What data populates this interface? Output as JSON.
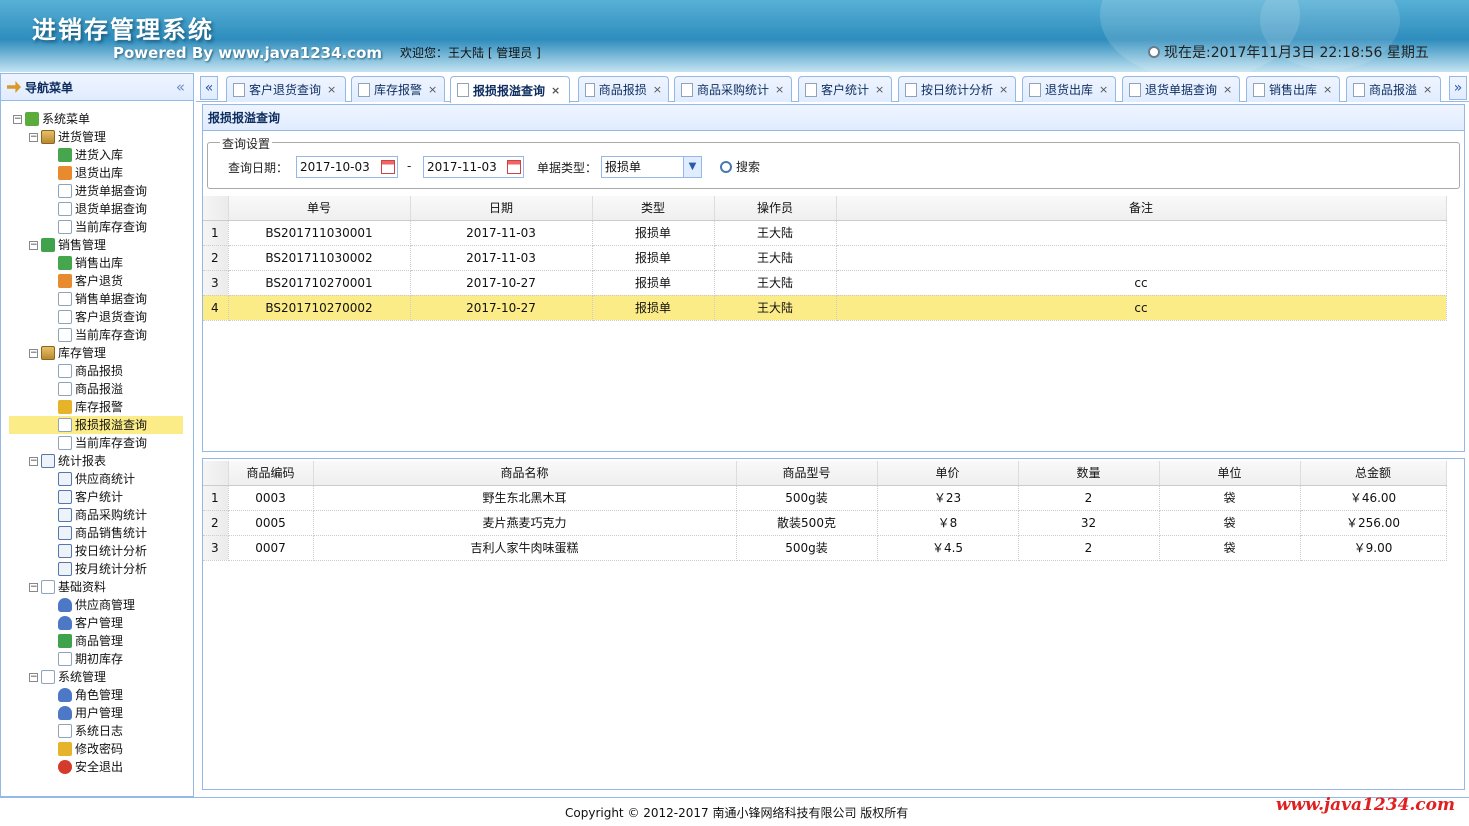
{
  "header": {
    "title": "进销存管理系统",
    "subtitle": "Powered By www.java1234.com",
    "welcome": "欢迎您：王大陆 [ 管理员 ]",
    "clock": "现在是:2017年11月3日 22:18:56 星期五"
  },
  "sidebar": {
    "title": "导航菜单",
    "collapse": "«",
    "root": "系统菜单",
    "groups": [
      {
        "label": "进货管理",
        "items": [
          "进货入库",
          "退货出库",
          "进货单据查询",
          "退货单据查询",
          "当前库存查询"
        ]
      },
      {
        "label": "销售管理",
        "items": [
          "销售出库",
          "客户退货",
          "销售单据查询",
          "客户退货查询",
          "当前库存查询"
        ]
      },
      {
        "label": "库存管理",
        "items": [
          "商品报损",
          "商品报溢",
          "库存报警",
          "报损报溢查询",
          "当前库存查询"
        ]
      },
      {
        "label": "统计报表",
        "items": [
          "供应商统计",
          "客户统计",
          "商品采购统计",
          "商品销售统计",
          "按日统计分析",
          "按月统计分析"
        ]
      },
      {
        "label": "基础资料",
        "items": [
          "供应商管理",
          "客户管理",
          "商品管理",
          "期初库存"
        ]
      },
      {
        "label": "系统管理",
        "items": [
          "角色管理",
          "用户管理",
          "系统日志",
          "修改密码",
          "安全退出"
        ]
      }
    ],
    "selected": "报损报溢查询"
  },
  "tabs": {
    "scroll_left": "«",
    "scroll_right": "»",
    "close": "×",
    "items": [
      "客户退货查询",
      "库存报警",
      "报损报溢查询",
      "商品报损",
      "商品采购统计",
      "客户统计",
      "按日统计分析",
      "退货出库",
      "退货单据查询",
      "销售出库",
      "商品报溢"
    ],
    "active": "报损报溢查询"
  },
  "query": {
    "panel_title": "报损报溢查询",
    "legend": "查询设置",
    "date_label": "查询日期：",
    "date_from": "2017-10-03",
    "dash": "-",
    "date_to": "2017-11-03",
    "type_label": "单据类型：",
    "type_value": "报损单",
    "search_label": "搜索"
  },
  "bill_table": {
    "columns": [
      "单号",
      "日期",
      "类型",
      "操作员",
      "备注"
    ],
    "rows": [
      {
        "n": "1",
        "no": "BS201711030001",
        "date": "2017-11-03",
        "type": "报损单",
        "op": "王大陆",
        "remark": ""
      },
      {
        "n": "2",
        "no": "BS201711030002",
        "date": "2017-11-03",
        "type": "报损单",
        "op": "王大陆",
        "remark": ""
      },
      {
        "n": "3",
        "no": "BS201710270001",
        "date": "2017-10-27",
        "type": "报损单",
        "op": "王大陆",
        "remark": "cc"
      },
      {
        "n": "4",
        "no": "BS201710270002",
        "date": "2017-10-27",
        "type": "报损单",
        "op": "王大陆",
        "remark": "cc"
      }
    ],
    "selected_row": "4"
  },
  "goods_table": {
    "columns": [
      "商品编码",
      "商品名称",
      "商品型号",
      "单价",
      "数量",
      "单位",
      "总金额"
    ],
    "rows": [
      {
        "n": "1",
        "code": "0003",
        "name": "野生东北黑木耳",
        "model": "500g装",
        "price": "￥23",
        "qty": "2",
        "unit": "袋",
        "total": "￥46.00"
      },
      {
        "n": "2",
        "code": "0005",
        "name": "麦片燕麦巧克力",
        "model": "散装500克",
        "price": "￥8",
        "qty": "32",
        "unit": "袋",
        "total": "￥256.00"
      },
      {
        "n": "3",
        "code": "0007",
        "name": "吉利人家牛肉味蛋糕",
        "model": "500g装",
        "price": "￥4.5",
        "qty": "2",
        "unit": "袋",
        "total": "￥9.00"
      }
    ]
  },
  "footer": {
    "copyright": "Copyright © 2012-2017 南通小锋网络科技有限公司 版权所有",
    "watermark": "www.java1234.com"
  }
}
